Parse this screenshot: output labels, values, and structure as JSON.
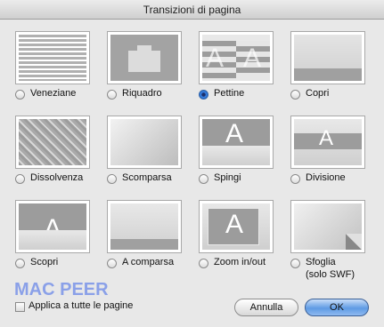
{
  "window": {
    "title": "Transizioni di pagina"
  },
  "transitions": [
    {
      "id": "veneziane",
      "label": "Veneziane",
      "selected": false
    },
    {
      "id": "riquadro",
      "label": "Riquadro",
      "selected": false
    },
    {
      "id": "pettine",
      "label": "Pettine",
      "selected": true
    },
    {
      "id": "copri",
      "label": "Copri",
      "selected": false
    },
    {
      "id": "dissolvenza",
      "label": "Dissolvenza",
      "selected": false
    },
    {
      "id": "scomparsa",
      "label": "Scomparsa",
      "selected": false
    },
    {
      "id": "spingi",
      "label": "Spingi",
      "selected": false
    },
    {
      "id": "divisione",
      "label": "Divisione",
      "selected": false
    },
    {
      "id": "scopri",
      "label": "Scopri",
      "selected": false
    },
    {
      "id": "a-comparsa",
      "label": "A comparsa",
      "selected": false
    },
    {
      "id": "zoom",
      "label": "Zoom in/out",
      "selected": false
    },
    {
      "id": "sfoglia",
      "label": "Sfoglia",
      "sublabel": "(solo SWF)",
      "selected": false
    }
  ],
  "preview_letter": "A",
  "watermark": "MAC PEER",
  "apply_all": {
    "label": "Applica a tutte le pagine",
    "checked": false
  },
  "buttons": {
    "cancel": "Annulla",
    "ok": "OK"
  },
  "colors": {
    "selected_radio": "#1e63c8",
    "default_button": "#5f9be4",
    "watermark": "#8aa0e8"
  }
}
